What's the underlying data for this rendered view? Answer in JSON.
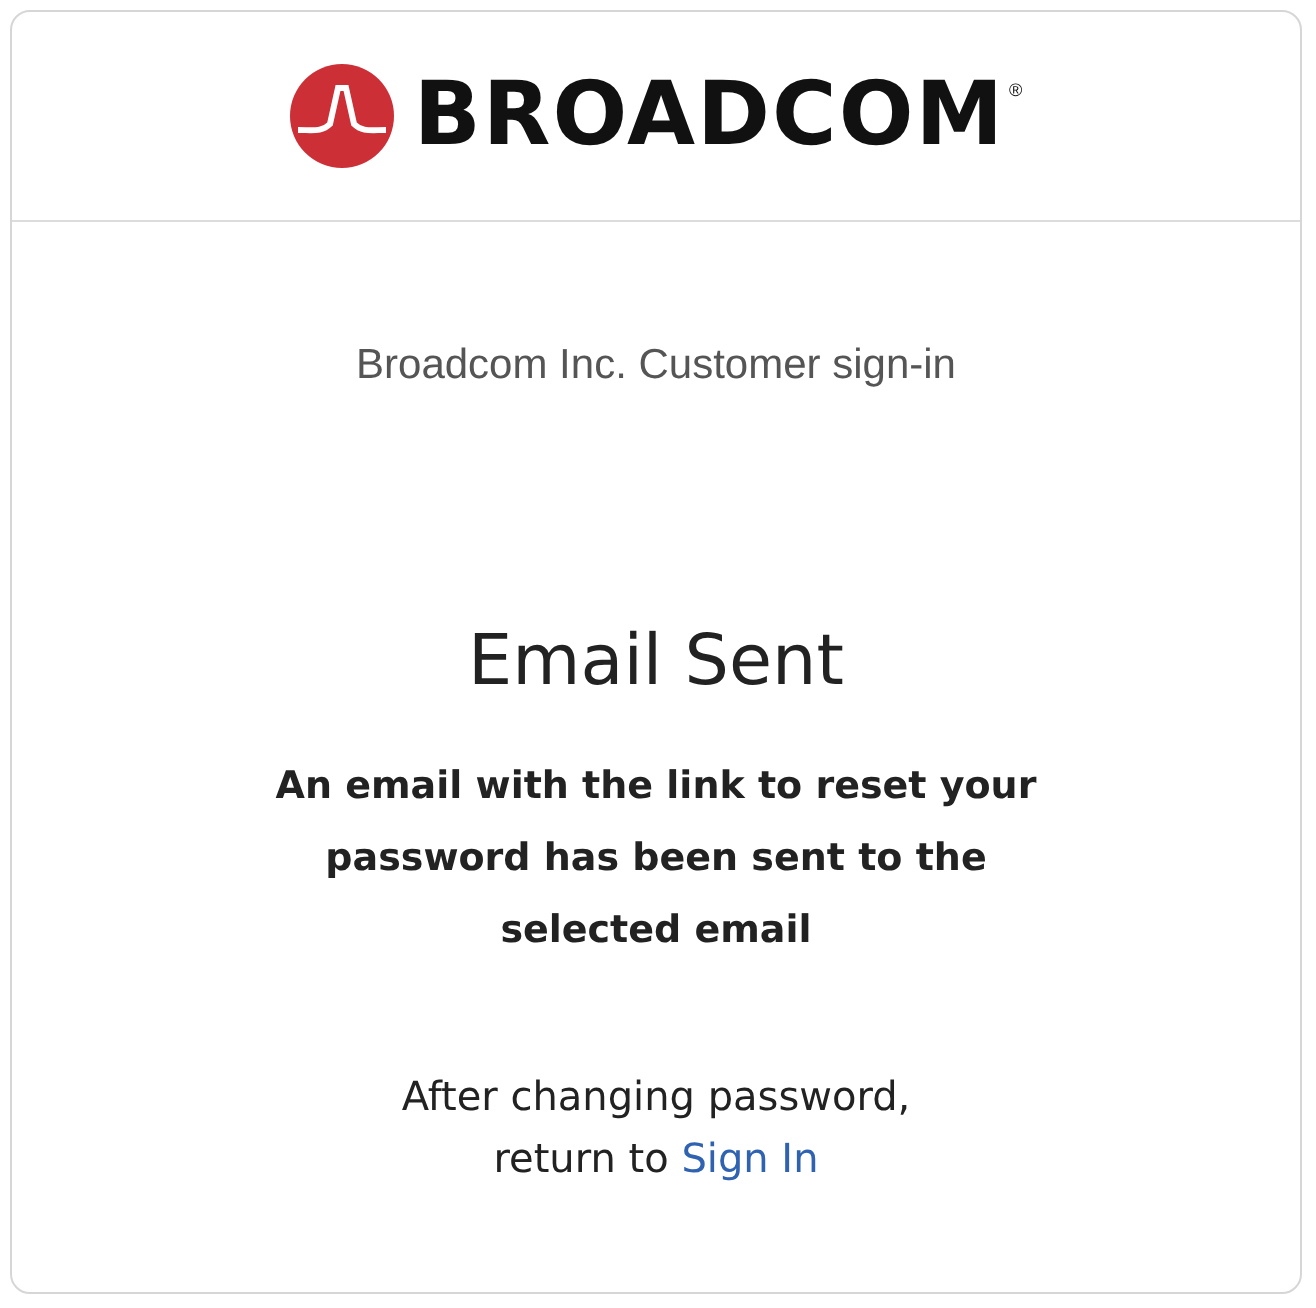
{
  "header": {
    "logo_text": "BROADCOM",
    "registered_mark": "®"
  },
  "subtitle": "Broadcom Inc. Customer sign-in",
  "heading": "Email Sent",
  "message": "An email with the link to reset your password has been sent to the selected email",
  "footer": {
    "line_1": "After changing password,",
    "line_2_prefix": "return to",
    "link": "Sign In"
  }
}
